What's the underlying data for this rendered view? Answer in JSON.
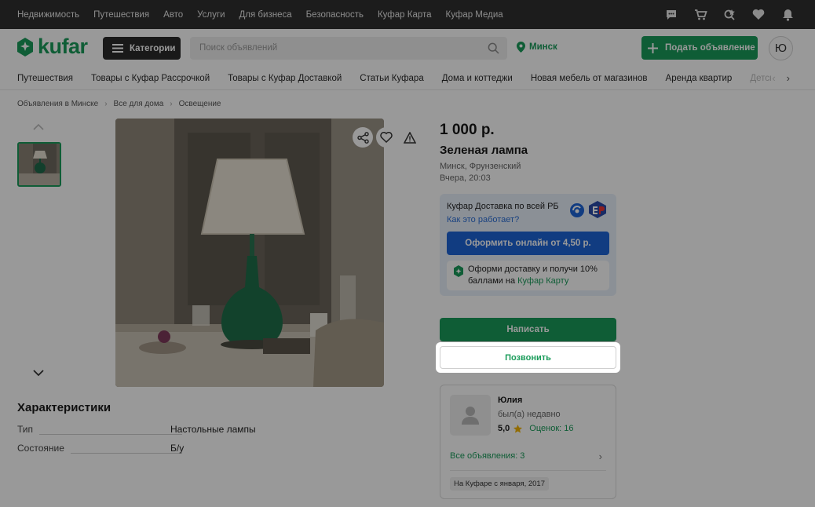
{
  "topbar": {
    "links": [
      "Недвижимость",
      "Путешествия",
      "Авто",
      "Услуги",
      "Для бизнеса",
      "Безопасность",
      "Куфар Карта",
      "Куфар Медиа"
    ]
  },
  "header": {
    "logo_text": "kufar",
    "categories_label": "Категории",
    "search_placeholder": "Поиск объявлений",
    "city": "Минск",
    "post_label": "Подать объявление",
    "avatar_letter": "Ю"
  },
  "nav": {
    "items": [
      "Путешествия",
      "Товары с Куфар Рассрочкой",
      "Товары с Куфар Доставкой",
      "Статьи Куфара",
      "Дома и коттеджи",
      "Новая мебель от магазинов",
      "Аренда квартир",
      "Детск"
    ]
  },
  "breadcrumbs": [
    "Объявления в Минске",
    "Все для дома",
    "Освещение"
  ],
  "listing": {
    "price": "1 000 р.",
    "title": "Зеленая лампа",
    "location": "Минск, Фрунзенский",
    "date": "Вчера, 20:03"
  },
  "delivery": {
    "title": "Куфар Доставка по всей РБ",
    "link": "Как это работает?",
    "button": "Оформить онлайн от 4,50 р.",
    "bonus_text": "Оформи доставку и получи 10% баллами на ",
    "bonus_link": "Куфар Карту"
  },
  "actions": {
    "write": "Написать",
    "call": "Позвонить"
  },
  "seller": {
    "name": "Юлия",
    "status": "был(а) недавно",
    "rating": "5,0",
    "reviews": "Оценок: 16",
    "all_ads": "Все объявления: 3",
    "since": "На Куфаре с января, 2017"
  },
  "characteristics": {
    "title": "Характеристики",
    "rows": [
      {
        "key": "Тип",
        "value": "Настольные лампы"
      },
      {
        "key": "Состояние",
        "value": "Б/у"
      }
    ]
  },
  "colors": {
    "brand_green": "#1a9c5a",
    "delivery_blue": "#1d64d8",
    "topbar": "#2f2f2f"
  }
}
